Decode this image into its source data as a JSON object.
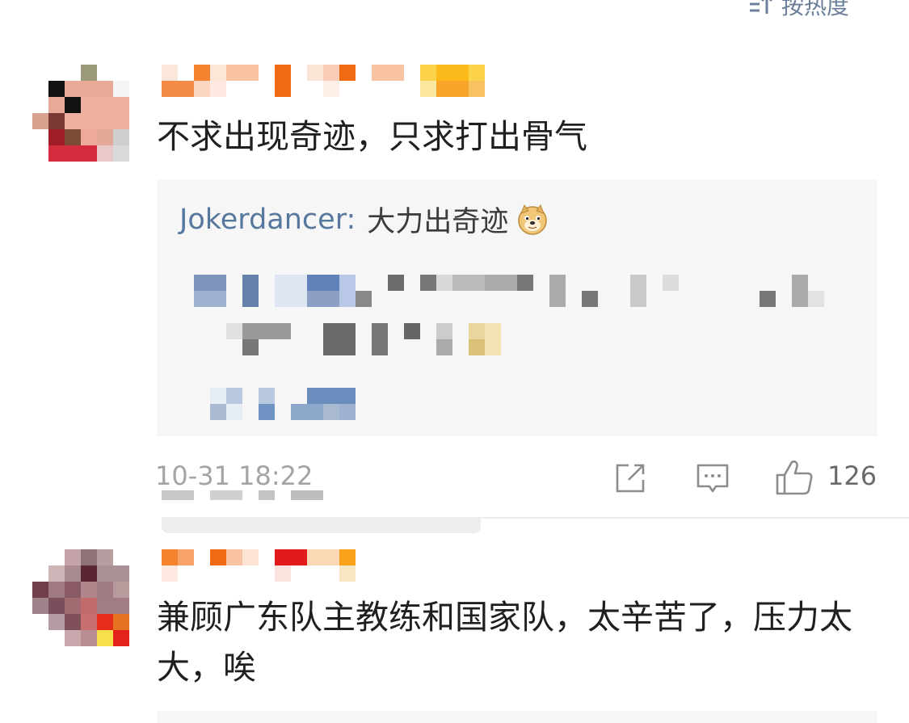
{
  "toolbar": {
    "sort_label": "按热度",
    "sort_icon": "sort-icon"
  },
  "comments": [
    {
      "text": "不求出现奇迹，只求打出骨气",
      "reply": {
        "user": "Jokerdancer:",
        "text": "大力出奇迹",
        "emoji": "doge-emoji"
      },
      "timestamp": "10-31 18:22",
      "likes": "126",
      "actions": [
        "share-icon",
        "comment-icon",
        "like-icon"
      ]
    },
    {
      "text": "兼顾广东队主教练和国家队，太辛苦了，压力太大，唉"
    }
  ],
  "colors": {
    "link_blue": "#56789e",
    "reply_bg": "#f6f6f6",
    "meta_gray": "#a4a4a4"
  }
}
